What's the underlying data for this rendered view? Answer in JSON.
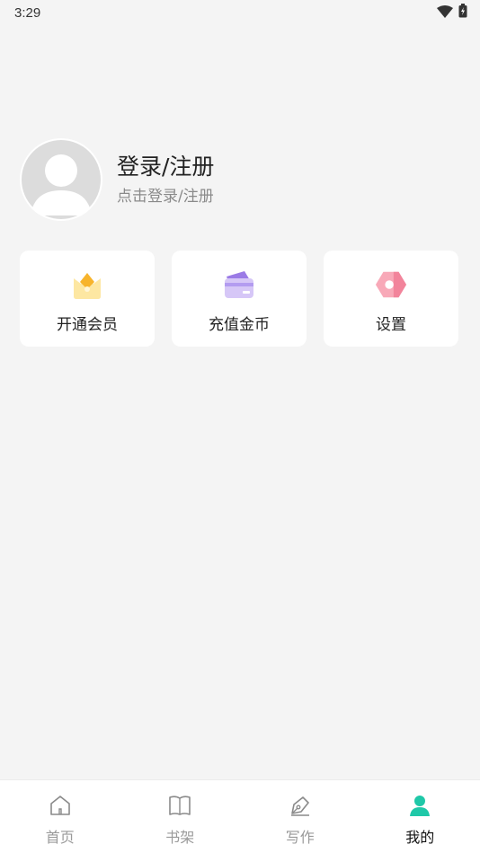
{
  "status_bar": {
    "time": "3:29"
  },
  "profile": {
    "title": "登录/注册",
    "subtitle": "点击登录/注册",
    "avatar_icon": "default-avatar-icon"
  },
  "quick_actions": [
    {
      "label": "开通会员",
      "icon": "crown-icon"
    },
    {
      "label": "充值金币",
      "icon": "card-icon"
    },
    {
      "label": "设置",
      "icon": "settings-gear-icon"
    }
  ],
  "tabbar": {
    "items": [
      {
        "label": "首页",
        "icon": "home-icon",
        "active": false
      },
      {
        "label": "书架",
        "icon": "book-icon",
        "active": false
      },
      {
        "label": "写作",
        "icon": "pen-icon",
        "active": false
      },
      {
        "label": "我的",
        "icon": "user-icon",
        "active": true
      }
    ],
    "active_color": "#1fc8a8"
  }
}
